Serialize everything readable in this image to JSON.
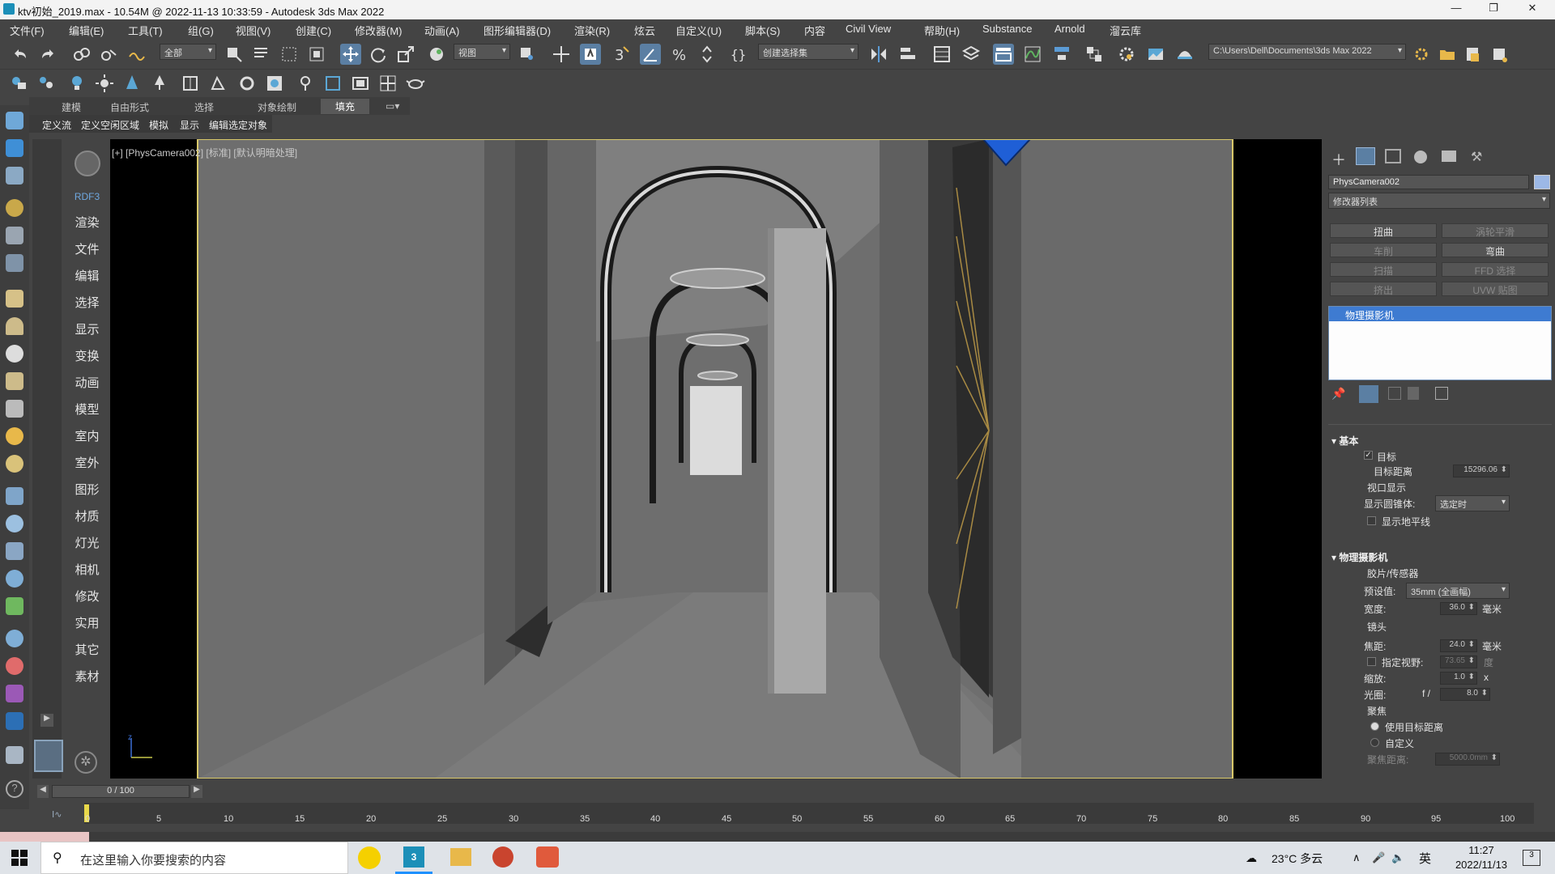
{
  "window": {
    "title": "ktv初始_2019.max - 10.54M @ 2022-11-13 10:33:59 - Autodesk 3ds Max 2022",
    "controls": {
      "minimize": "—",
      "maximize": "❐",
      "close": "✕"
    }
  },
  "menu": [
    "文件(F)",
    "编辑(E)",
    "工具(T)",
    "组(G)",
    "视图(V)",
    "创建(C)",
    "修改器(M)",
    "动画(A)",
    "图形编辑器(D)",
    "渲染(R)",
    "炫云",
    "自定义(U)",
    "脚本(S)",
    "内容",
    "Civil View",
    "帮助(H)",
    "Substance",
    "Arnold",
    "溜云库"
  ],
  "toolbar": {
    "selection_filter": "全部",
    "ref_coord": "视图",
    "named_selection": "创建选择集",
    "project_path": "C:\\Users\\Dell\\Documents\\3ds Max 2022",
    "snap_label": "3"
  },
  "ribbon": {
    "tabs": [
      "建模",
      "自由形式",
      "选择",
      "对象绘制",
      "填充"
    ],
    "active_tab": "填充",
    "subtools": [
      "定义流",
      "定义空闲区域",
      "模拟",
      "显示",
      "编辑选定对象"
    ]
  },
  "left_panel": {
    "header": "RDF3",
    "items": [
      "渲染",
      "文件",
      "编辑",
      "选择",
      "显示",
      "变换",
      "动画",
      "模型",
      "室内",
      "室外",
      "图形",
      "材质",
      "灯光",
      "相机",
      "修改",
      "实用",
      "其它",
      "素材"
    ]
  },
  "viewport": {
    "label": "[+] [PhysCamera002] [标准] [默认明暗处理]",
    "axis_label": "z"
  },
  "command_panel": {
    "object_name": "PhysCamera002",
    "modifier_list": "修改器列表",
    "buttons": [
      {
        "label": "扭曲",
        "enabled": true
      },
      {
        "label": "涡轮平滑",
        "enabled": false
      },
      {
        "label": "车削",
        "enabled": false
      },
      {
        "label": "弯曲",
        "enabled": true
      },
      {
        "label": "扫描",
        "enabled": false
      },
      {
        "label": "FFD 选择",
        "enabled": false
      },
      {
        "label": "挤出",
        "enabled": false
      },
      {
        "label": "UVW 贴图",
        "enabled": false
      }
    ],
    "stack_item": "物理摄影机",
    "basic": {
      "section": "基本",
      "target_label": "目标",
      "target_checked": "✓",
      "target_distance_label": "目标距离",
      "target_distance": "15296.06",
      "viewport_display": "视口显示",
      "show_cone_label": "显示圆锥体:",
      "show_cone_value": "选定时",
      "show_horizon": "显示地平线"
    },
    "camera": {
      "section": "物理摄影机",
      "film_sensor": "胶片/传感器",
      "preset_label": "预设值:",
      "preset_value": "35mm (全画幅)",
      "width_label": "宽度:",
      "width_value": "36.0",
      "unit_mm": "毫米",
      "lens": "镜头",
      "focal_label": "焦距:",
      "focal_value": "24.0",
      "fov_label": "指定视野:",
      "fov_value": "73.65",
      "fov_unit": "度",
      "zoom_label": "缩放:",
      "zoom_value": "1.0",
      "zoom_unit": "x",
      "aperture_label": "光圈:",
      "aperture_prefix": "f /",
      "aperture_value": "8.0",
      "focus": "聚焦",
      "use_target_distance": "使用目标距离",
      "custom": "自定义",
      "focus_distance_label": "聚焦距离:",
      "focus_distance_value": "5000.0mm"
    }
  },
  "timeline": {
    "frame_display": "0 / 100",
    "ticks": [
      "0",
      "5",
      "10",
      "15",
      "20",
      "25",
      "30",
      "35",
      "40",
      "45",
      "50",
      "55",
      "60",
      "65",
      "70",
      "75",
      "80",
      "85",
      "90",
      "95",
      "100"
    ]
  },
  "taskbar": {
    "search_placeholder": "在这里输入你要搜索的内容",
    "weather": "23°C 多云",
    "ime": "英",
    "time": "11:27",
    "date": "2022/11/13",
    "notifications": "3"
  },
  "colors": {
    "accent": "#5b7fa3",
    "selection": "#3e7bd1",
    "viewport_frame": "#d8c86a"
  }
}
